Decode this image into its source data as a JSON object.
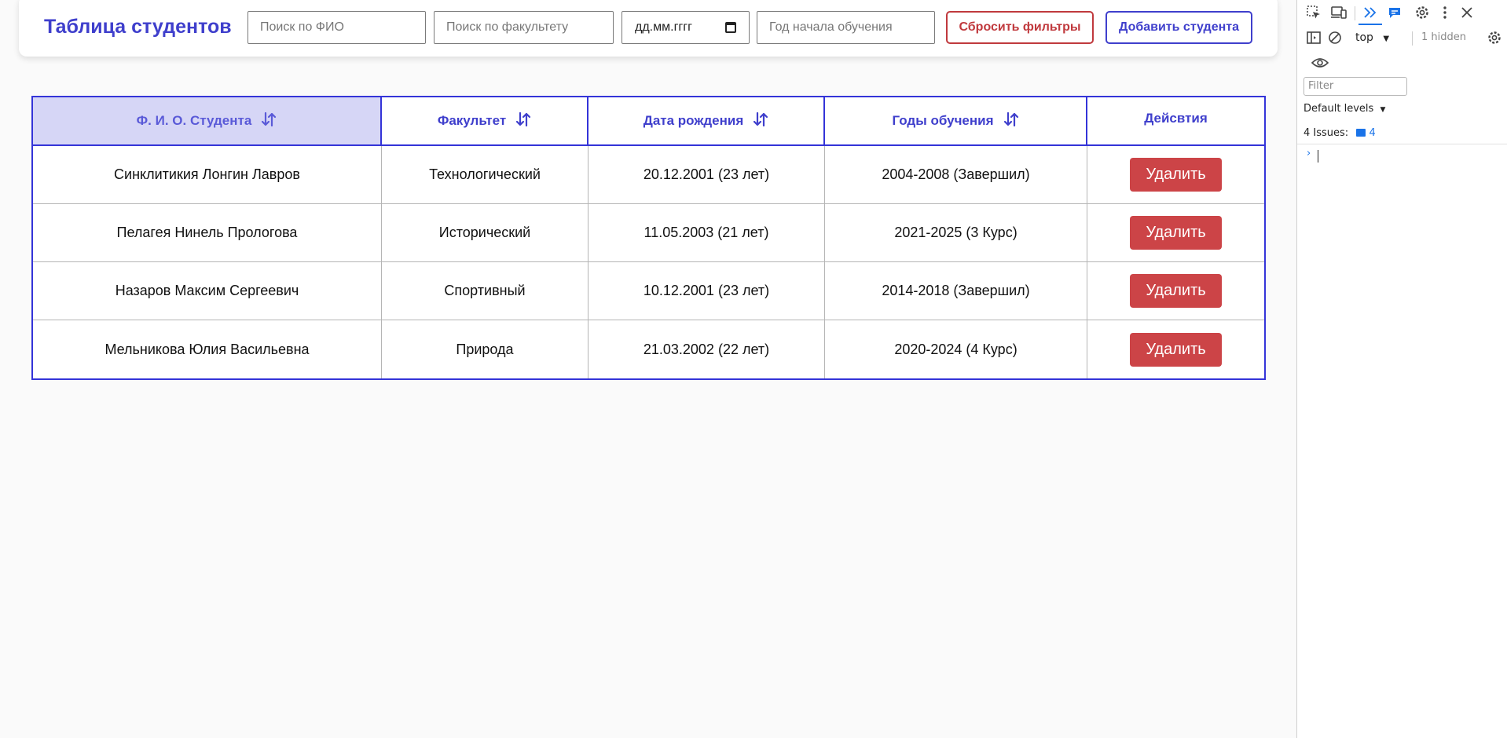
{
  "app": {
    "title": "Таблица студентов",
    "filters": {
      "name_placeholder": "Поиск по ФИО",
      "faculty_placeholder": "Поиск по факультету",
      "date_placeholder": "дд.мм.гггг",
      "start_year_placeholder": "Год начала обучения"
    },
    "reset_label": "Сбросить фильтры",
    "add_label": "Добавить студента"
  },
  "table": {
    "headers": [
      "Ф. И. О. Студента",
      "Факультет",
      "Дата рождения",
      "Годы обучения",
      "Дейсвтия"
    ],
    "sorted_column": 0,
    "delete_label": "Удалить",
    "rows": [
      [
        "Синклитикия Лонгин Лавров",
        "Технологический",
        "20.12.2001 (23 лет)",
        "2004-2008 (Завершил)"
      ],
      [
        "Пелагея Нинель Прологова",
        "Исторический",
        "11.05.2003 (21 лет)",
        "2021-2025 (3 Курс)"
      ],
      [
        "Назаров Максим Сергеевич",
        "Спортивный",
        "10.12.2001 (23 лет)",
        "2014-2018 (Завершил)"
      ],
      [
        "Мельникова Юлия Васильевна",
        "Природа",
        "21.03.2002 (22 лет)",
        "2020-2024 (4 Курс)"
      ]
    ]
  },
  "devtools": {
    "context": "top",
    "hidden": "1 hidden",
    "filter_placeholder": "Filter",
    "levels": "Default levels",
    "issues_label": "4 Issues:",
    "issues_count": "4"
  },
  "colors": {
    "accent": "#3f3fcc",
    "danger": "#cc4447",
    "header_active_bg": "#d6d6f6"
  }
}
